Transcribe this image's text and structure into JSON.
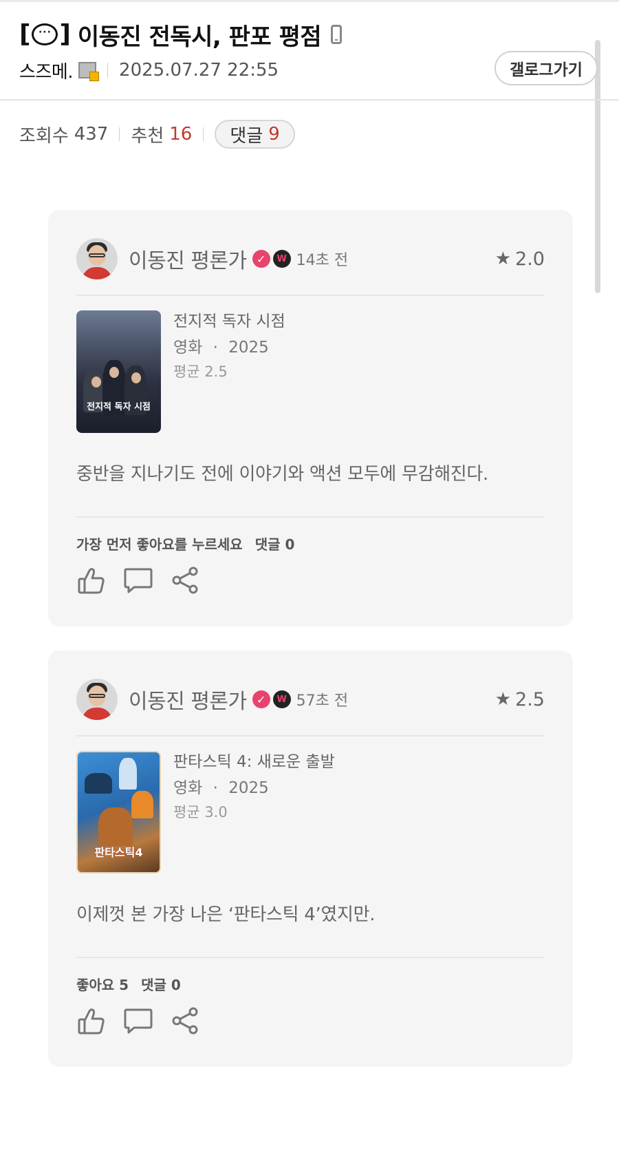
{
  "post": {
    "title": "이동진 전독시, 판포 평점",
    "title_bracket_left": "[",
    "title_bracket_right": "]",
    "title_icon_text": "···",
    "author": "스즈메.",
    "date": "2025.07.27 22:55",
    "gallery_button": "갤로그가기",
    "views_label": "조회수",
    "views": "437",
    "recommend_label": "추천",
    "recommend": "16",
    "comments_label": "댓글",
    "comments": "9",
    "accent_red": "#c0392b"
  },
  "reviews": [
    {
      "critic": "이동진 평론가",
      "verified_icon": "check-badge-icon",
      "badge": "W",
      "time": "14초 전",
      "rating": "2.0",
      "movie_title": "전지적 독자 시점",
      "movie_type": "영화",
      "movie_dot": "·",
      "movie_year": "2025",
      "movie_avg": "평균 2.5",
      "poster_title": "전지적 독자 시점",
      "review": "중반을 지나기도 전에 이야기와 액션 모두에 무감해진다.",
      "likes_text": "가장 먼저 좋아요를 누르세요",
      "comments_text": "댓글 0"
    },
    {
      "critic": "이동진 평론가",
      "verified_icon": "check-badge-icon",
      "badge": "W",
      "time": "57초 전",
      "rating": "2.5",
      "movie_title": "판타스틱 4: 새로운 출발",
      "movie_type": "영화",
      "movie_dot": "·",
      "movie_year": "2025",
      "movie_avg": "평균 3.0",
      "poster_title": "판타스틱4",
      "review": "이제껏 본 가장 나은 ‘판타스틱 4’였지만.",
      "likes_text": "좋아요 5",
      "comments_text": "댓글 0"
    }
  ]
}
